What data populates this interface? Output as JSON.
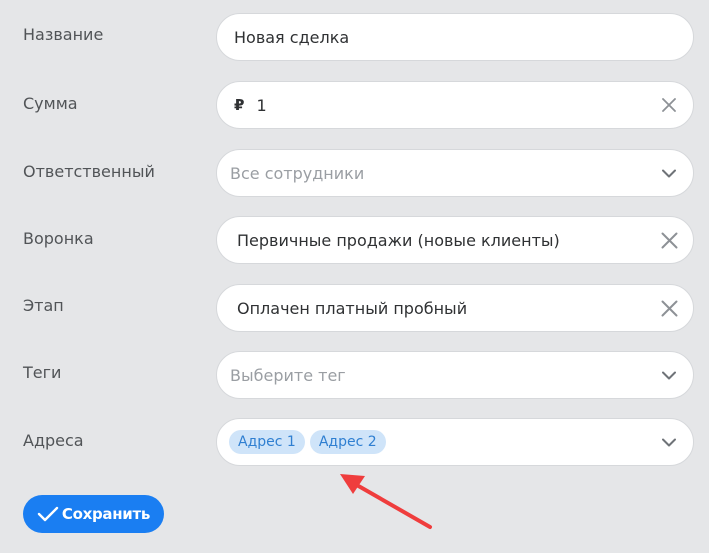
{
  "form": {
    "name": {
      "label": "Название",
      "value": "Новая сделка"
    },
    "amount": {
      "label": "Сумма",
      "currency": "₽",
      "value": "1",
      "clear_icon": "close-icon"
    },
    "responsible": {
      "label": "Ответственный",
      "placeholder": "Все сотрудники",
      "dropdown_icon": "chevron-down-icon"
    },
    "pipeline": {
      "label": "Воронка",
      "value": "Первичные продажи (новые клиенты)",
      "clear_icon": "close-icon"
    },
    "stage": {
      "label": "Этап",
      "value": "Оплачен платный пробный",
      "clear_icon": "close-icon"
    },
    "tags": {
      "label": "Теги",
      "placeholder": "Выберите тег",
      "dropdown_icon": "chevron-down-icon"
    },
    "addresses": {
      "label": "Адреса",
      "chips": [
        "Адрес 1",
        "Адрес 2"
      ],
      "dropdown_icon": "chevron-down-icon"
    }
  },
  "save_button": {
    "label": "Сохранить",
    "icon": "check-icon"
  },
  "colors": {
    "background": "#e5e6e8",
    "accent": "#1a7ef2",
    "chip_bg": "#cfe4f9",
    "chip_text": "#2f7fd1",
    "annotation_arrow": "#ef3d3d"
  }
}
